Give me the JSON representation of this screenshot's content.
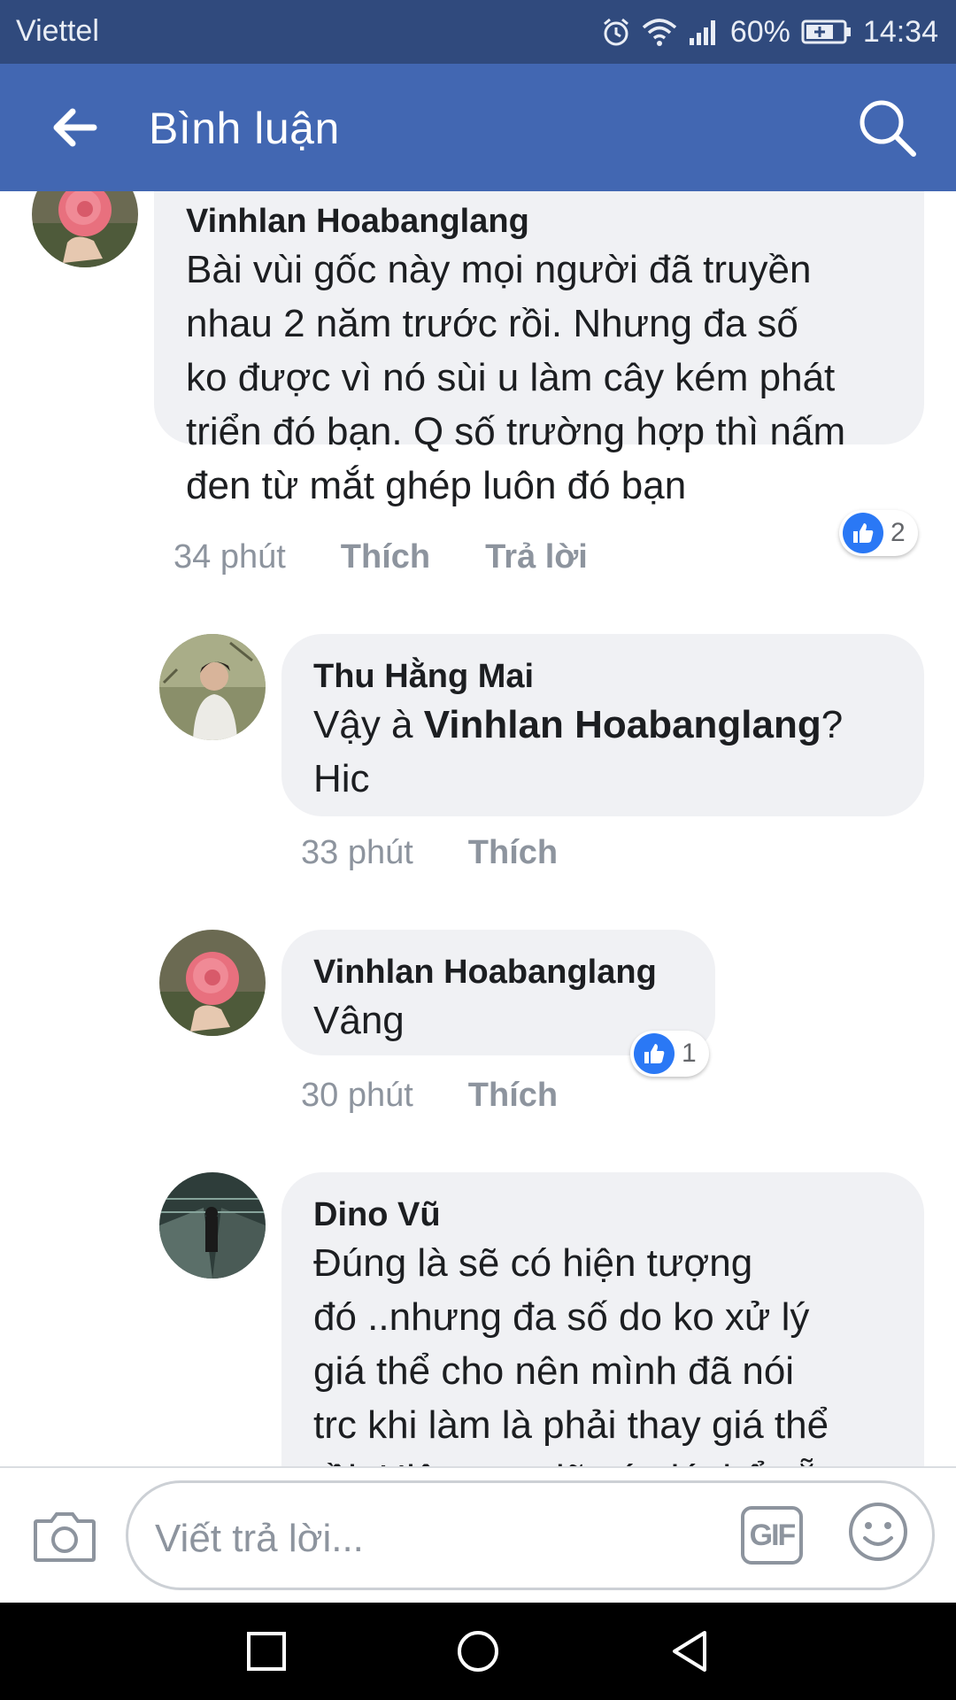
{
  "status": {
    "carrier": "Viettel",
    "battery": "60%",
    "time": "14:34"
  },
  "header": {
    "title": "Bình luận",
    "back_icon": "arrow-left-icon",
    "search_icon": "search-icon"
  },
  "comments": [
    {
      "author": "Vinhlan Hoabanglang",
      "lines": [
        "Bài vùi gốc này mọi người đã truyền",
        "nhau 2 năm trước rồi. Nhưng đa số",
        "ko được vì nó sùi u làm cây kém phát",
        "triển đó bạn. Q số trường hợp thì nấm",
        "đen từ mắt ghép luôn đó bạn"
      ],
      "time": "34 phút",
      "like_label": "Thích",
      "reply_label": "Trả lời",
      "likes": "2"
    },
    {
      "author": "Thu Hằng Mai",
      "text_prefix": "Vậy à ",
      "mention": "Vinhlan Hoabanglang",
      "text_suffix": "?",
      "line2": "Hic",
      "time": "33 phút",
      "like_label": "Thích"
    },
    {
      "author": "Vinhlan Hoabanglang",
      "text": "Vâng",
      "time": "30 phút",
      "like_label": "Thích",
      "likes": "1"
    },
    {
      "author": "Dino Vũ",
      "lines": [
        "Đúng là sẽ có hiện tượng",
        "đó ..nhưng đa số do ko xử lý",
        "giá thể cho nên mình đã nói",
        "trc khi làm là phải thay giá thể",
        "rồi. Hiện nay đã có giá thể sẵn"
      ]
    }
  ],
  "composer": {
    "placeholder": "Viết trả lời...",
    "gif_label": "GIF",
    "camera_icon": "camera-icon",
    "emoji_icon": "smiley-icon"
  },
  "colors": {
    "header": "#4267b2",
    "statusbar": "#304a7d",
    "bubble": "#f0f1f4",
    "like": "#2a78f5"
  }
}
